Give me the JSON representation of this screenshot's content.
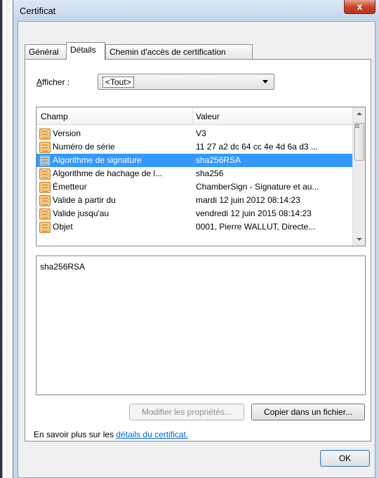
{
  "window": {
    "title": "Certificat",
    "close_label": "x"
  },
  "tabs": [
    {
      "label": "Général"
    },
    {
      "label": "Détails"
    },
    {
      "label": "Chemin d'accès de certification"
    }
  ],
  "show": {
    "label_prefix": "A",
    "label_rest": "fficher :",
    "selected": "<Tout>"
  },
  "list": {
    "col_field": "Champ",
    "col_value": "Valeur",
    "rows": [
      {
        "field": "Version",
        "value": "V3"
      },
      {
        "field": "Numéro de série",
        "value": "11 27 a2 dc 64 cc 4e 4d 6a d3 ..."
      },
      {
        "field": "Algorithme de signature",
        "value": "sha256RSA"
      },
      {
        "field": "Algorithme de hachage de l...",
        "value": "sha256"
      },
      {
        "field": "Émetteur",
        "value": "ChamberSign - Signature et au..."
      },
      {
        "field": "Valide à partir du",
        "value": "mardi 12 juin 2012 08:14:23"
      },
      {
        "field": "Valide jusqu'au",
        "value": "vendredi 12 juin 2015 08:14:23"
      },
      {
        "field": "Objet",
        "value": "0001, Pierre WALLUT, Directe..."
      }
    ],
    "selected_index": 2
  },
  "detail": {
    "text": "sha256RSA"
  },
  "buttons": {
    "edit_properties": "Modifier les propriétés...",
    "copy_to_file": "Copier dans un fichier...",
    "ok": "OK"
  },
  "learn_more": {
    "prefix": "En savoir plus sur les ",
    "link": "détails du certificat."
  },
  "colors": {
    "selection": "#3399ff",
    "link": "#0066cc",
    "close_button": "#c7452c"
  }
}
